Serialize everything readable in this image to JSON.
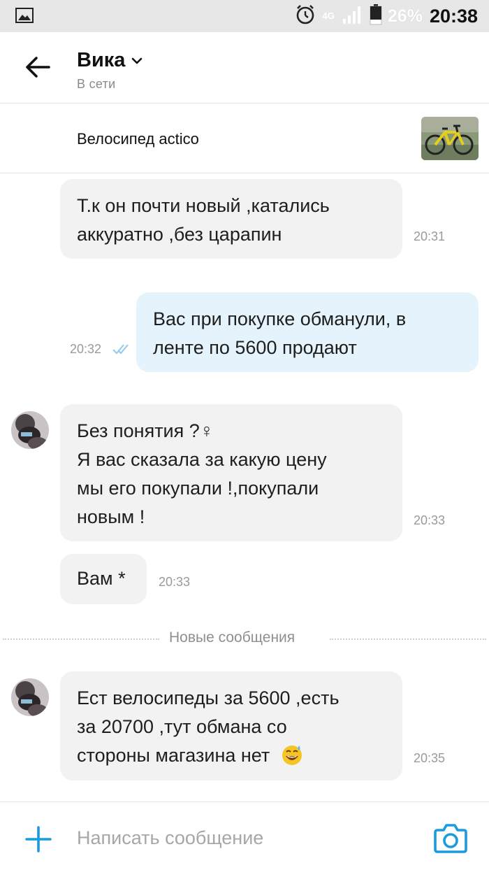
{
  "status_bar": {
    "network": "4G",
    "battery": "26%",
    "time": "20:38"
  },
  "header": {
    "contact_name": "Вика",
    "contact_status": "В сети"
  },
  "listing": {
    "title": "Велосипед actico"
  },
  "messages": [
    {
      "direction": "incoming",
      "lines": [
        "Т.к он почти новый ,катались",
        "аккуратно ,без царапин"
      ],
      "time": "20:31"
    },
    {
      "direction": "outgoing",
      "lines": [
        "Вас при покупке обманули, в",
        "ленте по 5600 продают"
      ],
      "time": "20:32",
      "read": true
    },
    {
      "direction": "incoming",
      "lines": [
        "Без понятия ?♀",
        "Я вас сказала за какую цену",
        "мы его покупали !,покупали",
        "новым !"
      ],
      "time": "20:33"
    },
    {
      "direction": "incoming",
      "lines": [
        "Вам *"
      ],
      "time": "20:33"
    },
    {
      "direction": "incoming",
      "lines": [
        "Ест велосипеды за 5600 ,есть",
        "за 20700 ,тут обмана со",
        "стороны магазина нет"
      ],
      "time": "20:35",
      "emoji": "grinning-sweat-emoji"
    }
  ],
  "divider": {
    "label": "Новые сообщения"
  },
  "composer": {
    "placeholder": "Написать сообщение"
  },
  "colors": {
    "accent": "#1a9be0",
    "incoming_bubble": "#f2f2f2",
    "outgoing_bubble": "#e5f4fc",
    "statusbar": "#e7e7e7"
  }
}
